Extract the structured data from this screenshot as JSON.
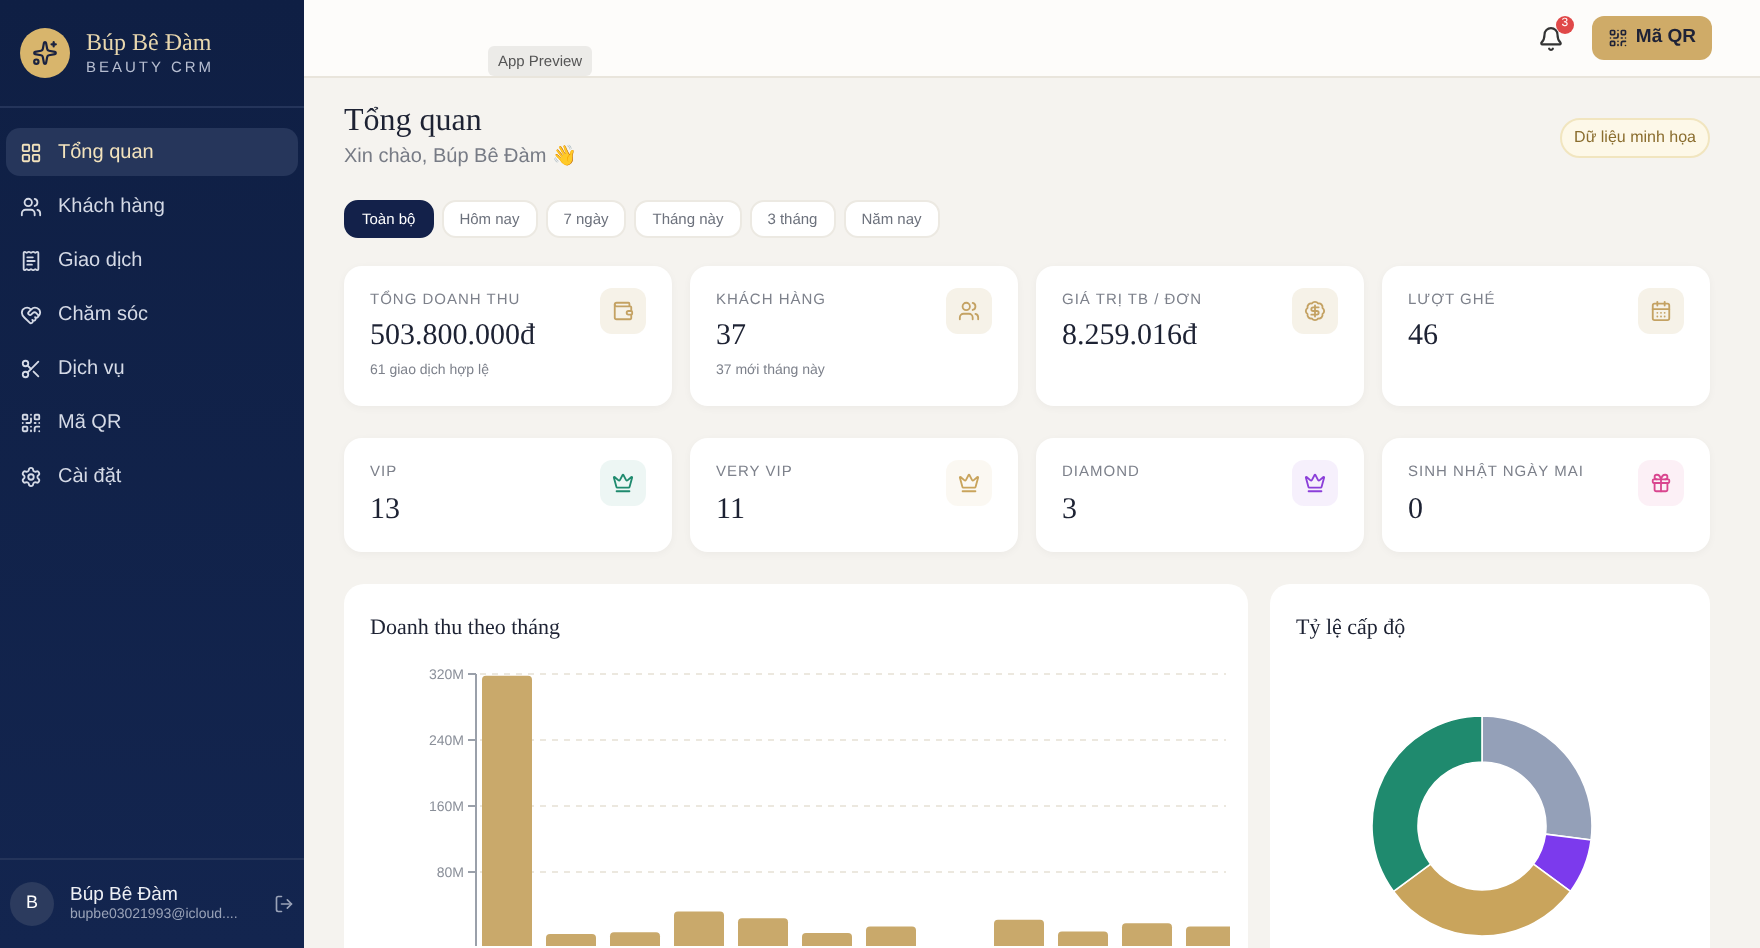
{
  "sidebar": {
    "brand": {
      "name": "Búp Bê Đàm",
      "tagline": "BEAUTY CRM"
    },
    "items": [
      {
        "label": "Tổng quan",
        "selected": true
      },
      {
        "label": "Khách hàng",
        "selected": false
      },
      {
        "label": "Giao dịch",
        "selected": false
      },
      {
        "label": "Chăm sóc",
        "selected": false
      },
      {
        "label": "Dịch vụ",
        "selected": false
      },
      {
        "label": "Mã QR",
        "selected": false
      },
      {
        "label": "Cài đặt",
        "selected": false
      }
    ],
    "user": {
      "initial": "B",
      "name": "Búp Bê Đàm",
      "email": "bupbe03021993@icloud...."
    }
  },
  "preview_badge": "App Preview",
  "header": {
    "notification_count": "3",
    "qr_button": "Mã QR"
  },
  "page": {
    "title": "Tổng quan",
    "greeting": "Xin chào, Búp Bê Đàm 👋",
    "demo_badge": "Dữ liệu minh họa"
  },
  "tabs": [
    {
      "label": "Toàn bộ",
      "selected": true
    },
    {
      "label": "Hôm nay",
      "selected": false
    },
    {
      "label": "7 ngày",
      "selected": false
    },
    {
      "label": "Tháng này",
      "selected": false
    },
    {
      "label": "3 tháng",
      "selected": false
    },
    {
      "label": "Năm nay",
      "selected": false
    }
  ],
  "stats": [
    {
      "label": "TỔNG DOANH THU",
      "value": "503.800.000đ",
      "note": "61 giao dịch hợp lệ"
    },
    {
      "label": "KHÁCH HÀNG",
      "value": "37",
      "note": "37 mới tháng này"
    },
    {
      "label": "GIÁ TRỊ TB / ĐƠN",
      "value": "8.259.016đ"
    },
    {
      "label": "LƯỢT GHÉ",
      "value": "46"
    }
  ],
  "tiers": [
    {
      "label": "VIP",
      "value": "13",
      "color": "#1f8a6e"
    },
    {
      "label": "VERY VIP",
      "value": "11",
      "color": "#c9a45c"
    },
    {
      "label": "DIAMOND",
      "value": "3",
      "color": "#8b3fd9"
    },
    {
      "label": "SINH NHẬT NGÀY MAI",
      "value": "0",
      "color": "#d9468f"
    }
  ],
  "revenue_chart": {
    "title": "Doanh thu theo tháng",
    "chart_data": {
      "type": "bar",
      "ylim": [
        0,
        320
      ],
      "yticks": [
        {
          "value": 80,
          "label": "80M"
        },
        {
          "value": 160,
          "label": "160M"
        },
        {
          "value": 240,
          "label": "240M"
        },
        {
          "value": 320,
          "label": "320M"
        }
      ],
      "grid": true,
      "series": [
        {
          "color": "#c9a96b",
          "values": [
            318,
            5,
            7,
            32,
            24,
            6,
            14,
            null,
            22,
            8,
            18,
            14
          ]
        }
      ]
    }
  },
  "tier_chart": {
    "title": "Tỷ lệ cấp độ"
  }
}
